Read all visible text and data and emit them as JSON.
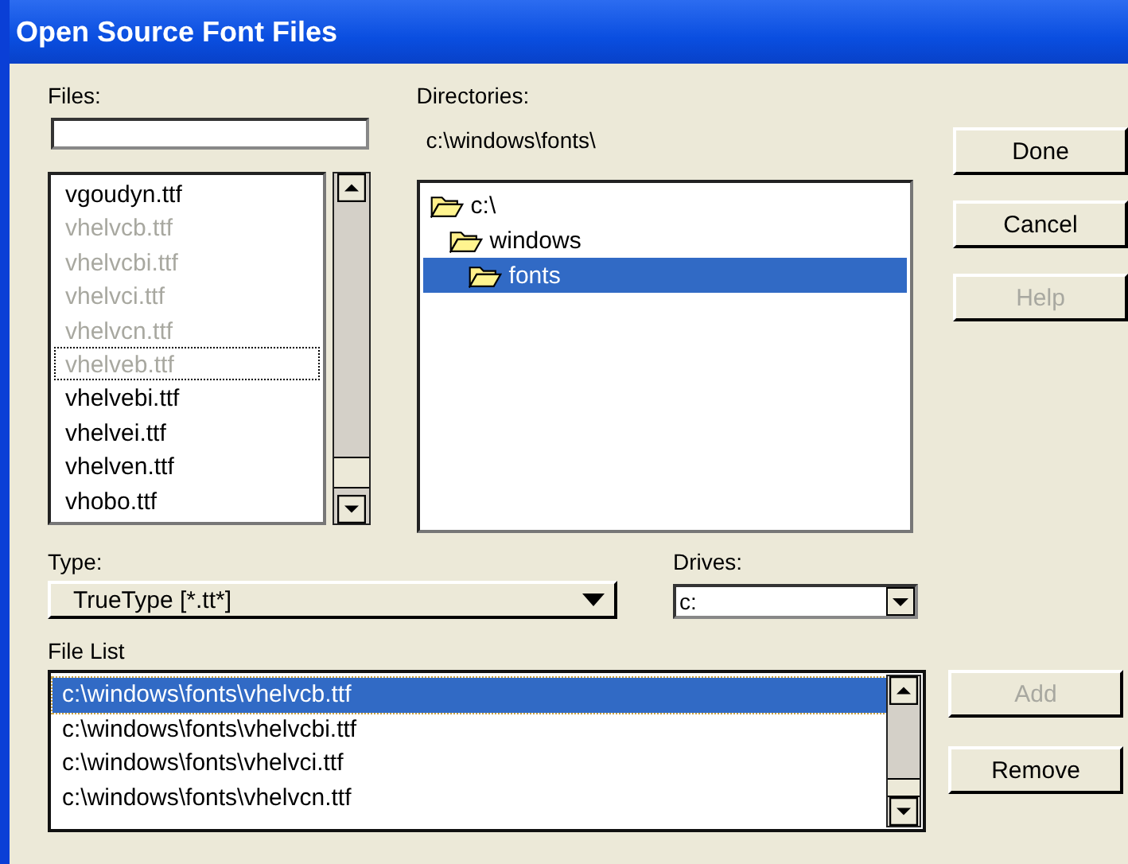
{
  "window": {
    "title": "Open Source Font Files"
  },
  "files": {
    "label": "Files:",
    "items": [
      {
        "name": "vgoudyn.ttf",
        "disabled": false,
        "focused": false
      },
      {
        "name": "vhelvcb.ttf",
        "disabled": true,
        "focused": false
      },
      {
        "name": "vhelvcbi.ttf",
        "disabled": true,
        "focused": false
      },
      {
        "name": "vhelvci.ttf",
        "disabled": true,
        "focused": false
      },
      {
        "name": "vhelvcn.ttf",
        "disabled": true,
        "focused": false
      },
      {
        "name": "vhelveb.ttf",
        "disabled": true,
        "focused": true
      },
      {
        "name": "vhelvebi.ttf",
        "disabled": false,
        "focused": false
      },
      {
        "name": "vhelvei.ttf",
        "disabled": false,
        "focused": false
      },
      {
        "name": "vhelven.ttf",
        "disabled": false,
        "focused": false
      },
      {
        "name": "vhobo.ttf",
        "disabled": false,
        "focused": false
      }
    ]
  },
  "directories": {
    "label": "Directories:",
    "path": "c:\\windows\\fonts\\",
    "tree": [
      {
        "name": "c:\\",
        "selected": false,
        "children": [
          {
            "name": "windows",
            "selected": false,
            "children": [
              {
                "name": "fonts",
                "selected": true
              }
            ]
          }
        ]
      }
    ]
  },
  "buttons": [
    {
      "label": "Done",
      "disabled": false
    },
    {
      "label": "Cancel",
      "disabled": false
    },
    {
      "label": "Help",
      "disabled": true
    }
  ],
  "type": {
    "label": "Type:",
    "value": "TrueType [*.tt*]"
  },
  "drives": {
    "label": "Drives:",
    "value": "c:"
  },
  "file_list": {
    "label": "File List",
    "items": [
      {
        "path": "c:\\windows\\fonts\\vhelvcb.ttf",
        "selected": true
      },
      {
        "path": "c:\\windows\\fonts\\vhelvcbi.ttf",
        "selected": false
      },
      {
        "path": "c:\\windows\\fonts\\vhelvci.ttf",
        "selected": false
      },
      {
        "path": "c:\\windows\\fonts\\vhelvcn.ttf",
        "selected": false
      }
    ]
  },
  "list_buttons": [
    {
      "label": "Add",
      "disabled": true
    },
    {
      "label": "Remove",
      "disabled": false
    }
  ]
}
